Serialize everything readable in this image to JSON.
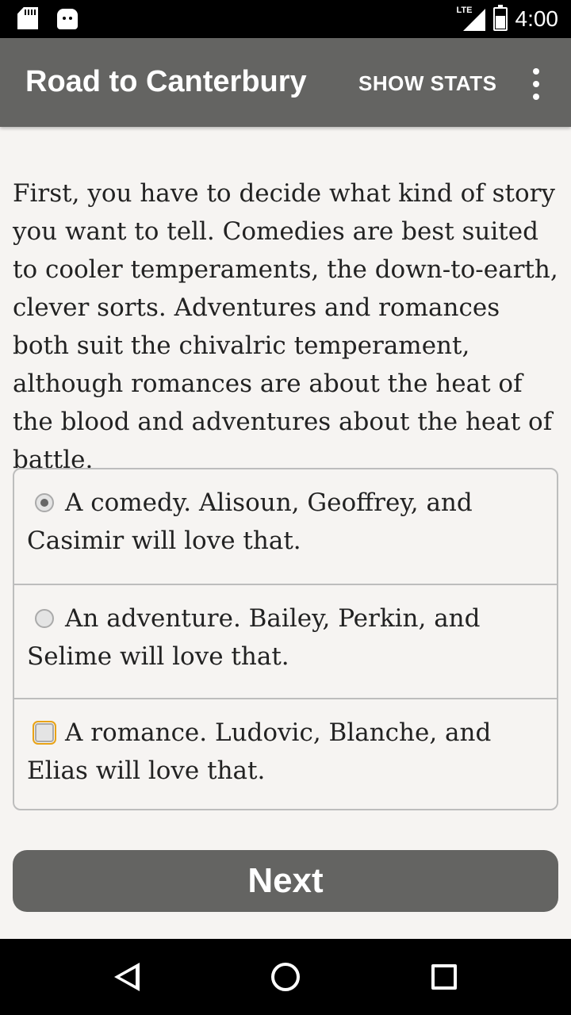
{
  "status_bar": {
    "network_label": "LTE",
    "time": "4:00",
    "icons": [
      "sd-card-icon",
      "android-icon",
      "signal-icon",
      "battery-icon"
    ]
  },
  "app_bar": {
    "title": "Road to Canterbury",
    "show_stats_label": "SHOW STATS",
    "overflow_icon": "more-vert-icon"
  },
  "story": {
    "text": "First, you have to decide what kind of story you want to tell. Comedies are best suited to cooler temperaments, the down-to-earth, clever sorts. Adventures and romances both suit the chivalric temperament, although romances are about the heat of the blood and adventures about the heat of battle."
  },
  "choices": [
    {
      "label": "A comedy. Alisoun, Geoffrey, and Casimir will love that.",
      "selected": true
    },
    {
      "label": "An adventure. Bailey, Perkin, and Selime will love that.",
      "selected": false
    },
    {
      "label": "A romance. Ludovic, Blanche, and Elias will love that.",
      "selected": false,
      "focused": true
    }
  ],
  "next_button": {
    "label": "Next"
  },
  "nav_bar": {
    "icons": [
      "back-icon",
      "home-icon",
      "recents-icon"
    ]
  },
  "colors": {
    "app_bar": "#646462",
    "background": "#f6f4f2",
    "button": "#646462",
    "focus_ring": "#e8a317"
  }
}
